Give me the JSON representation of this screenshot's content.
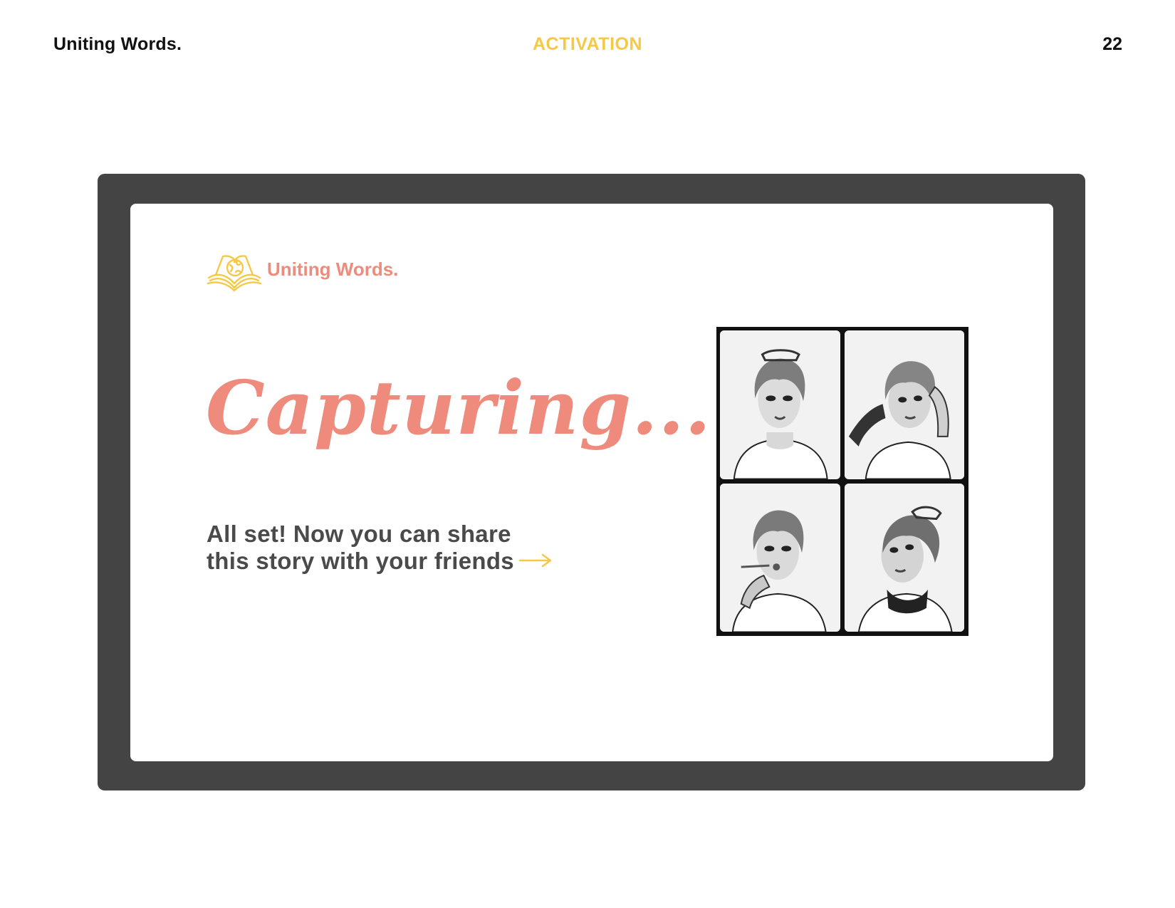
{
  "page_header": {
    "brand": "Uniting Words.",
    "section": "ACTIVATION",
    "page_number": "22"
  },
  "screen": {
    "logo": {
      "icon": "open-book-globe-icon",
      "text": "Uniting Words."
    },
    "headline": "Capturing...",
    "message": {
      "line1": "All set! Now you can share",
      "line2": "this story with your friends",
      "arrow_icon": "right-arrow-icon"
    },
    "photo_strip": {
      "photos": [
        {
          "pose": "front-facing-portrait"
        },
        {
          "pose": "hand-in-hair-portrait"
        },
        {
          "pose": "smoking-portrait"
        },
        {
          "pose": "looking-up-portrait"
        }
      ]
    }
  },
  "colors": {
    "accent_coral": "#ee8b7c",
    "accent_yellow": "#f5c945",
    "frame_dark": "#444444",
    "text_dark": "#111111",
    "text_gray": "#4a4a4a"
  }
}
